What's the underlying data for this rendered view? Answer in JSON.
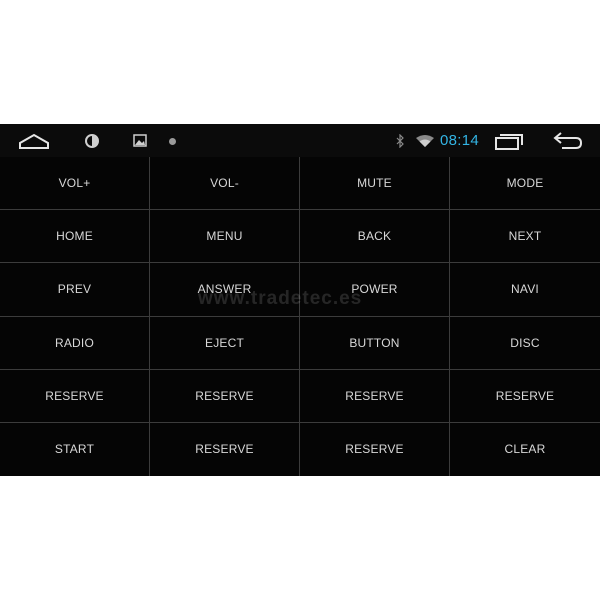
{
  "status_bar": {
    "time": "08:14",
    "icons": [
      "home-icon",
      "brightness-icon",
      "gallery-icon",
      "media-dot-icon",
      "bluetooth-icon",
      "wifi-icon",
      "recent-apps-icon",
      "back-icon"
    ],
    "accent_color": "#33b5e5"
  },
  "keys": [
    "VOL+",
    "VOL-",
    "MUTE",
    "MODE",
    "HOME",
    "MENU",
    "BACK",
    "NEXT",
    "PREV",
    "ANSWER",
    "POWER",
    "NAVI",
    "RADIO",
    "EJECT",
    "BUTTON",
    "DISC",
    "RESERVE",
    "RESERVE",
    "RESERVE",
    "RESERVE",
    "START",
    "RESERVE",
    "RESERVE",
    "CLEAR"
  ],
  "watermark": "www.tradetec.es"
}
